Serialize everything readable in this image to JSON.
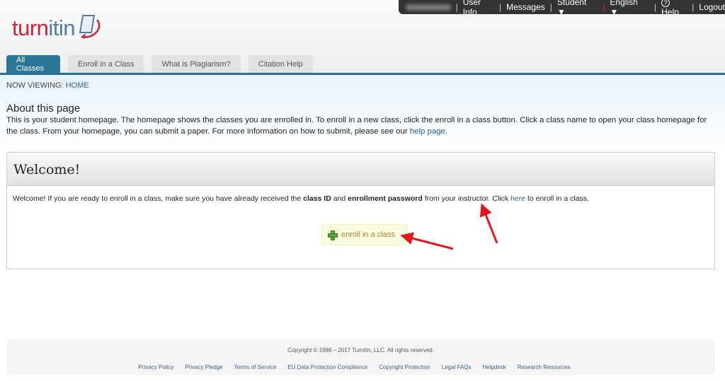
{
  "topbar": {
    "items": [
      "User Info",
      "Messages",
      "Student ▼",
      "English ▼",
      "Help",
      "Logout"
    ],
    "help_icon": "?"
  },
  "logo": {
    "part1": "turn",
    "part2": "itin"
  },
  "tabs": [
    {
      "label": "All Classes",
      "active": true
    },
    {
      "label": "Enroll in a Class"
    },
    {
      "label": "What is Plagiarism?"
    },
    {
      "label": "Citation Help"
    }
  ],
  "breadcrumb": {
    "prefix": "NOW VIEWING: ",
    "current": "HOME"
  },
  "about": {
    "title": "About this page",
    "text1": "This is your student homepage. The homepage shows the classes you are enrolled in. To enroll in a new class, click the enroll in a class button. Click a class name to open your class homepage for the class. From your homepage, you can submit a paper. For more information on how to submit, please see our ",
    "link": "help page",
    "text2": "."
  },
  "welcome": {
    "title": "Welcome!",
    "t1": "Welcome! If you are ready to enroll in a class, make sure you have already received the ",
    "b1": "class ID",
    "t2": " and ",
    "b2": "enrollment password",
    "t3": " from your instructor. Click ",
    "link": "here",
    "t4": " to enroll in a class.",
    "button": "enroll in a class"
  },
  "footer": {
    "copyright": "Copyright © 1998 – 2017 Turnitin, LLC. All rights reserved.",
    "links": [
      "Privacy Policy",
      "Privacy Pledge",
      "Terms of Service",
      "EU Data Protection Compliance",
      "Copyright Protection",
      "Legal FAQs",
      "Helpdesk",
      "Research Resources"
    ]
  },
  "colors": {
    "brand_red": "#d0203a",
    "tab_active": "#2b7596",
    "arrow": "#e8141c"
  }
}
